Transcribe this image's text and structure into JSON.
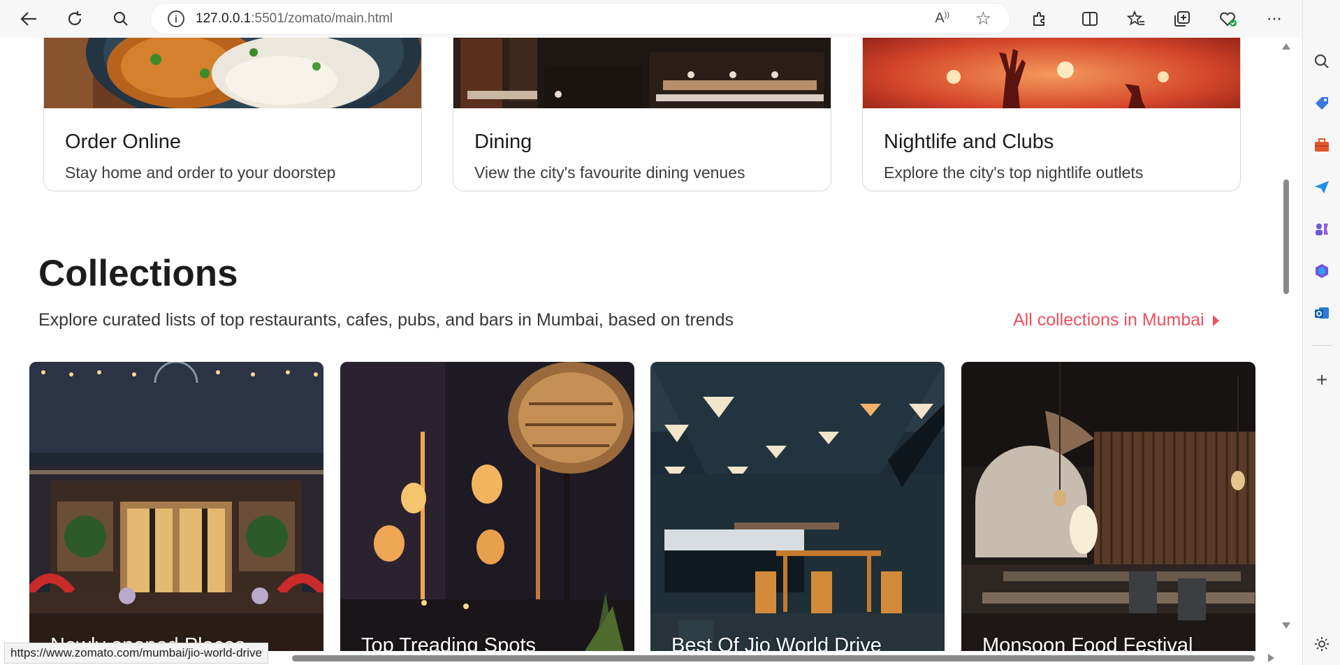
{
  "browser": {
    "url_host": "127.0.0.1",
    "url_rest": ":5501/zomato/main.html",
    "status_url": "https://www.zomato.com/mumbai/jio-world-drive"
  },
  "cards": [
    {
      "title": "Order Online",
      "desc": "Stay home and order to your doorstep"
    },
    {
      "title": "Dining",
      "desc": "View the city's favourite dining venues"
    },
    {
      "title": "Nightlife and Clubs",
      "desc": "Explore the city's top nightlife outlets"
    }
  ],
  "collections": {
    "title": "Collections",
    "subtitle": "Explore curated lists of top restaurants, cafes, pubs, and bars in Mumbai, based on trends",
    "link": "All collections in Mumbai",
    "items": [
      {
        "label": "Newly opened Places"
      },
      {
        "label": "Top Treading Spots"
      },
      {
        "label": "Best Of Jio World Drive"
      },
      {
        "label": "Monsoon Food Festival"
      }
    ]
  },
  "colors": {
    "accent": "#ef4f5f"
  }
}
